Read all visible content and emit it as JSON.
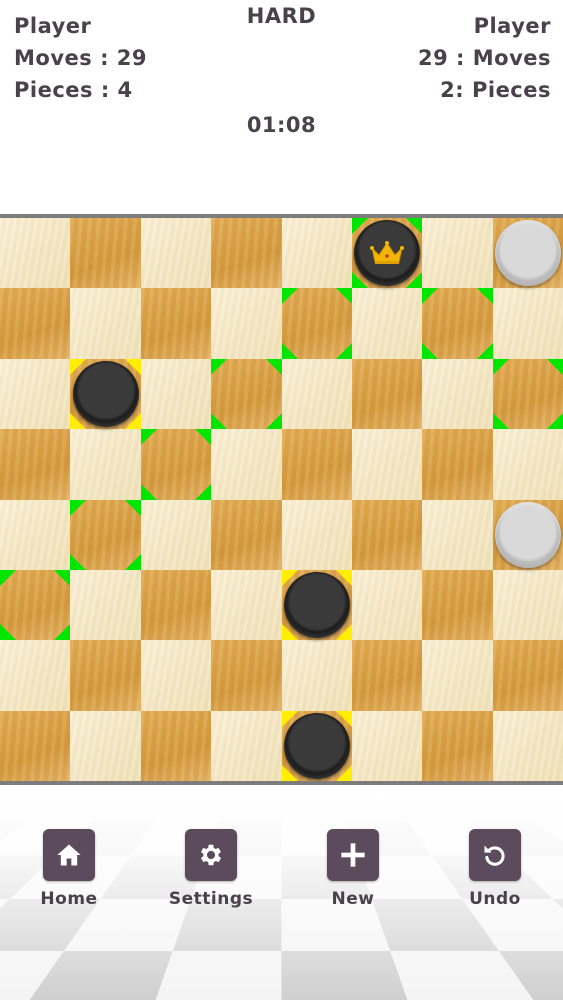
{
  "header": {
    "left_player": "Player",
    "left_moves": "Moves : 29",
    "left_pieces": "Pieces : 4",
    "right_player": "Player",
    "right_moves": "29 : Moves",
    "right_pieces": "2: Pieces",
    "difficulty": "HARD",
    "timer": "01:08"
  },
  "board": {
    "size": 8,
    "light_color": "#f6e8c4",
    "dark_color": "#dca44b",
    "highlight_green": "#00e600",
    "highlight_yellow": "#ffee00",
    "pieces": [
      {
        "row": 0,
        "col": 5,
        "color": "black",
        "king": true,
        "icon": "crown-icon"
      },
      {
        "row": 0,
        "col": 7,
        "color": "white",
        "king": false
      },
      {
        "row": 2,
        "col": 1,
        "color": "black",
        "king": false
      },
      {
        "row": 4,
        "col": 7,
        "color": "white",
        "king": false
      },
      {
        "row": 5,
        "col": 4,
        "color": "black",
        "king": false
      },
      {
        "row": 7,
        "col": 4,
        "color": "black",
        "king": false
      }
    ],
    "green_highlights": [
      {
        "row": 0,
        "col": 5
      },
      {
        "row": 1,
        "col": 4
      },
      {
        "row": 1,
        "col": 6
      },
      {
        "row": 2,
        "col": 3
      },
      {
        "row": 2,
        "col": 7
      },
      {
        "row": 3,
        "col": 2
      },
      {
        "row": 4,
        "col": 1
      },
      {
        "row": 5,
        "col": 0
      }
    ],
    "yellow_highlights": [
      {
        "row": 2,
        "col": 1
      },
      {
        "row": 5,
        "col": 4
      },
      {
        "row": 7,
        "col": 4
      }
    ]
  },
  "controls": [
    {
      "id": "home",
      "label": "Home",
      "icon": "home-icon"
    },
    {
      "id": "settings",
      "label": "Settings",
      "icon": "gear-icon"
    },
    {
      "id": "new",
      "label": "New",
      "icon": "plus-icon"
    },
    {
      "id": "undo",
      "label": "Undo",
      "icon": "undo-icon"
    }
  ]
}
